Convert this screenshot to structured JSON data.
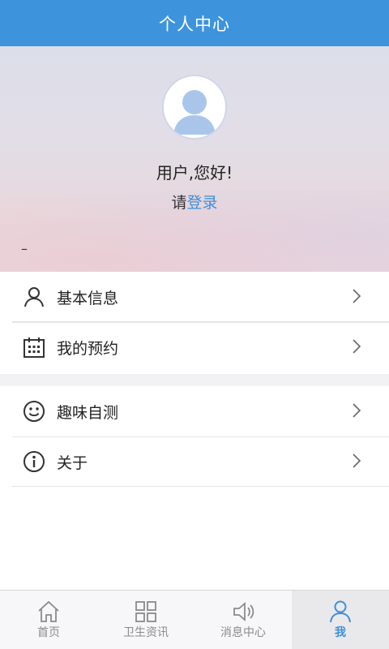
{
  "header": {
    "title": "个人中心"
  },
  "profile": {
    "greeting": "用户,您好!",
    "login_prefix": "请",
    "login_link": "登录",
    "dash": "–"
  },
  "menu_groups": [
    [
      {
        "label": "基本信息",
        "icon": "user-icon"
      },
      {
        "label": "我的预约",
        "icon": "calendar-icon"
      }
    ],
    [
      {
        "label": "趣味自测",
        "icon": "smile-icon"
      },
      {
        "label": "关于",
        "icon": "info-icon"
      }
    ]
  ],
  "tabbar": [
    {
      "label": "首页",
      "icon": "home-icon",
      "active": false
    },
    {
      "label": "卫生资讯",
      "icon": "grid-icon",
      "active": false
    },
    {
      "label": "消息中心",
      "icon": "speaker-icon",
      "active": false
    },
    {
      "label": "我",
      "icon": "user-icon",
      "active": true
    }
  ],
  "colors": {
    "accent": "#3d94dc",
    "link": "#3d8fd8",
    "inactive": "#8a8a8a"
  }
}
